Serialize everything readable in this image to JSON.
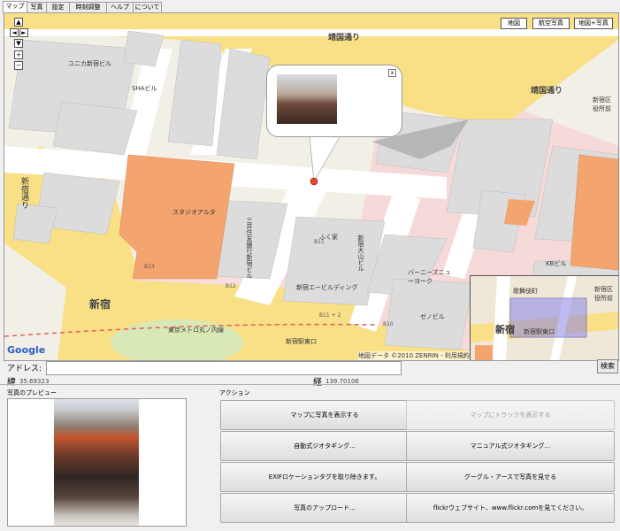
{
  "tabs": [
    "マップ",
    "写真",
    "設定",
    "時刻調整",
    "ヘルプ",
    "について"
  ],
  "map": {
    "type_buttons": [
      "地図",
      "航空写真",
      "地図+写真"
    ],
    "nav": {
      "up": "▲",
      "left": "◄",
      "right": "►",
      "down": "▼",
      "zoom_in": "+",
      "zoom_out": "−"
    },
    "labels": {
      "yasukuni_1": "靖国通り",
      "yasukuni_2": "靖国通り",
      "shinjuku_dori": "新宿通り",
      "shinjuku": "新宿",
      "metro": "東京メトロ丸ノ内線",
      "east_exit": "新宿駅東口",
      "ward_office": "新宿区役所前",
      "unika": "ユニカ新宿ビル",
      "sha": "SHAビル",
      "studio_alta": "スタジオアルタ",
      "mitsui": "三井住友銀行新宿ビル",
      "fukuya": "ふく家",
      "oyama": "新宿大山ビル",
      "enebldg": "新宿エービルディング",
      "barneys": "バーニーズニューヨーク",
      "zeno": "ゼノビル",
      "kb": "KBビル",
      "copyright": "地図データ ©2010 ZENRIN - 利用規約",
      "google": "Google"
    },
    "route_numbers": [
      "B11-2",
      "B11",
      "B12",
      "B13",
      "B10",
      "B11 + 2",
      "21",
      "23"
    ],
    "bubble_close": "x",
    "minimap": {
      "labels": [
        "新宿",
        "新宿駅東口",
        "新宿区役所前",
        "歌舞伎町"
      ]
    }
  },
  "address": {
    "label": "アドレス:",
    "value": "",
    "go": "検索"
  },
  "coords": {
    "lat_label": "緯",
    "lat_value": "35.69323",
    "lng_label": "経",
    "lng_value": "139.70106"
  },
  "preview": {
    "title": "写真のプレビュー"
  },
  "actions": {
    "title": "アクション",
    "buttons": [
      {
        "label": "マップに写真を表示する",
        "enabled": true
      },
      {
        "label": "マップにトラックを表示する",
        "enabled": false
      },
      {
        "label": "自動式ジオタギング...",
        "enabled": true
      },
      {
        "label": "マニュアル式ジオタギング...",
        "enabled": true
      },
      {
        "label": "EXIFロケーションタグを取り除きます。",
        "enabled": true
      },
      {
        "label": "グーグル・アースで写真を見せる",
        "enabled": true
      },
      {
        "label": "写真のアップロード...",
        "enabled": true
      },
      {
        "label": "flickrウェブサイト、www.flickr.comを見てください。",
        "enabled": true
      }
    ]
  },
  "colors": {
    "road_major": "#f9df86",
    "road_minor": "#ffffff",
    "building": "#dcdcdc",
    "landmark": "#f4a46e",
    "park": "#d8e8b6"
  }
}
